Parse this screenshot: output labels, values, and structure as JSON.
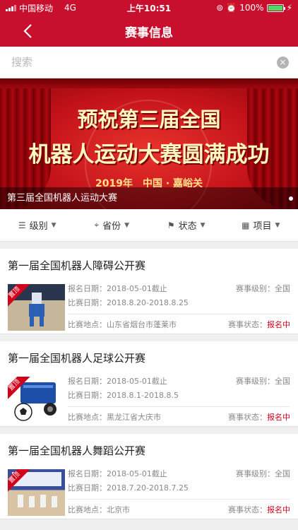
{
  "status_bar": {
    "carrier": "中国移动",
    "network": "4G",
    "time": "上午10:51",
    "battery": "100%",
    "battery_level": 1.0
  },
  "nav": {
    "title": "赛事信息"
  },
  "search": {
    "placeholder": "搜索"
  },
  "banner": {
    "line1": "预祝第三届全国",
    "line2": "机器人运动大赛圆满成功",
    "sub": "2019年　中国 · 嘉峪关",
    "caption": "第三届全国机器人运动大赛"
  },
  "filters": [
    {
      "label": "级别",
      "icon": "list-icon"
    },
    {
      "label": "省份",
      "icon": "location-icon"
    },
    {
      "label": "状态",
      "icon": "flag-icon"
    },
    {
      "label": "项目",
      "icon": "grid-icon"
    }
  ],
  "events": [
    {
      "title": "第一届全国机器人障碍公开赛",
      "tag": "置顶",
      "reg_date": "报名日期：2018-05-01截止",
      "level": "赛事级别：全国",
      "match_date": "比赛日期：2018.8.20-2018.8.25",
      "place": "比赛地点：山东省烟台市蓬莱市",
      "status_label": "赛事状态：",
      "status_value": "报名中"
    },
    {
      "title": "第一届全国机器人足球公开赛",
      "tag": "置顶",
      "reg_date": "报名日期：2018-05-01截止",
      "level": "赛事级别：全国",
      "match_date": "比赛日期：2018.8.1-2018.8.5",
      "place": "比赛地点：黑龙江省大庆市",
      "status_label": "赛事状态：",
      "status_value": "报名中"
    },
    {
      "title": "第一届全国机器人舞蹈公开赛",
      "tag": "置顶",
      "reg_date": "报名日期：2018-05-01截止",
      "level": "赛事级别：全国",
      "match_date": "比赛日期：2018.7.20-2018.7.25",
      "place": "比赛地点：北京市",
      "status_label": "赛事状态：",
      "status_value": "报名中"
    }
  ],
  "colors": {
    "brand": "#c8102e",
    "status": "#d0021b"
  }
}
